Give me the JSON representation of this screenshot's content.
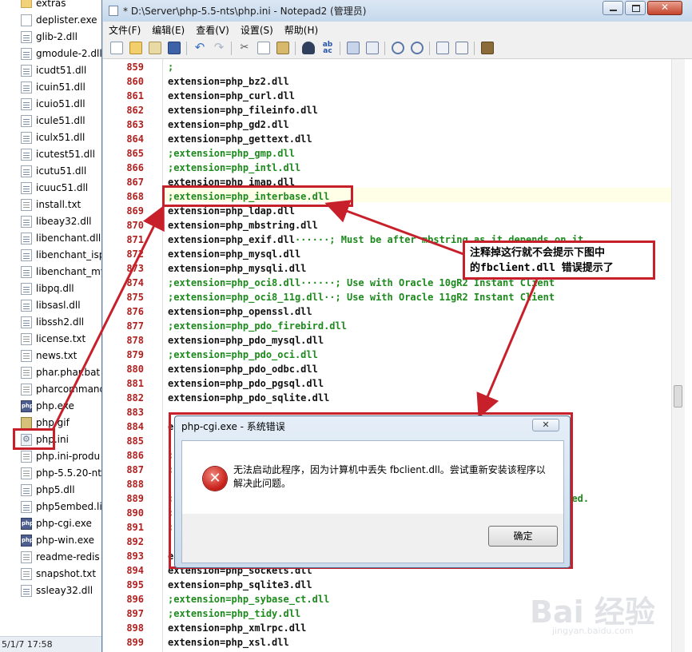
{
  "explorer": {
    "files": [
      {
        "name": "extras",
        "icon": "folder"
      },
      {
        "name": "deplister.exe",
        "icon": "exe"
      },
      {
        "name": "glib-2.dll",
        "icon": "dll"
      },
      {
        "name": "gmodule-2.dll",
        "icon": "dll"
      },
      {
        "name": "icudt51.dll",
        "icon": "dll"
      },
      {
        "name": "icuin51.dll",
        "icon": "dll"
      },
      {
        "name": "icuio51.dll",
        "icon": "dll"
      },
      {
        "name": "icule51.dll",
        "icon": "dll"
      },
      {
        "name": "iculx51.dll",
        "icon": "dll"
      },
      {
        "name": "icutest51.dll",
        "icon": "dll"
      },
      {
        "name": "icutu51.dll",
        "icon": "dll"
      },
      {
        "name": "icuuc51.dll",
        "icon": "dll"
      },
      {
        "name": "install.txt",
        "icon": "txt"
      },
      {
        "name": "libeay32.dll",
        "icon": "dll"
      },
      {
        "name": "libenchant.dll",
        "icon": "dll"
      },
      {
        "name": "libenchant_isp",
        "icon": "dll"
      },
      {
        "name": "libenchant_my",
        "icon": "dll"
      },
      {
        "name": "libpq.dll",
        "icon": "dll"
      },
      {
        "name": "libsasl.dll",
        "icon": "dll"
      },
      {
        "name": "libssh2.dll",
        "icon": "dll"
      },
      {
        "name": "license.txt",
        "icon": "txt"
      },
      {
        "name": "news.txt",
        "icon": "txt"
      },
      {
        "name": "phar.phar.bat",
        "icon": "txt"
      },
      {
        "name": "pharcommand",
        "icon": "txt"
      },
      {
        "name": "php.exe",
        "icon": "php"
      },
      {
        "name": "php.gif",
        "icon": "gif"
      },
      {
        "name": "php.ini",
        "icon": "ini"
      },
      {
        "name": "php.ini-produ",
        "icon": "txt"
      },
      {
        "name": "php-5.5.20-nt",
        "icon": "txt"
      },
      {
        "name": "php5.dll",
        "icon": "dll"
      },
      {
        "name": "php5embed.li",
        "icon": "dll"
      },
      {
        "name": "php-cgi.exe",
        "icon": "php"
      },
      {
        "name": "php-win.exe",
        "icon": "php"
      },
      {
        "name": "readme-redis",
        "icon": "txt"
      },
      {
        "name": "snapshot.txt",
        "icon": "txt"
      },
      {
        "name": "ssleay32.dll",
        "icon": "dll"
      }
    ],
    "status": "5/1/7 17:58"
  },
  "notepad": {
    "title": "* D:\\Server\\php-5.5-nts\\php.ini - Notepad2 (管理员)",
    "menu": [
      "文件(F)",
      "编辑(E)",
      "查看(V)",
      "设置(S)",
      "帮助(H)"
    ],
    "lines": [
      {
        "n": "859",
        "t": ";",
        "c": true
      },
      {
        "n": "860",
        "t": "extension=php_bz2.dll",
        "c": false
      },
      {
        "n": "861",
        "t": "extension=php_curl.dll",
        "c": false
      },
      {
        "n": "862",
        "t": "extension=php_fileinfo.dll",
        "c": false
      },
      {
        "n": "863",
        "t": "extension=php_gd2.dll",
        "c": false
      },
      {
        "n": "864",
        "t": "extension=php_gettext.dll",
        "c": false
      },
      {
        "n": "865",
        "t": ";extension=php_gmp.dll",
        "c": true
      },
      {
        "n": "866",
        "t": ";extension=php_intl.dll",
        "c": true
      },
      {
        "n": "867",
        "t": "extension=php_imap.dll",
        "c": false
      },
      {
        "n": "868",
        "t": ";extension=php_interbase.dll",
        "c": true
      },
      {
        "n": "869",
        "t": "extension=php_ldap.dll",
        "c": false
      },
      {
        "n": "870",
        "t": "extension=php_mbstring.dll",
        "c": false
      },
      {
        "n": "871",
        "t": "extension=php_exif.dll",
        "c": false,
        "tail": "······; Must be after mbstring as it depends on it"
      },
      {
        "n": "872",
        "t": "extension=php_mysql.dll",
        "c": false
      },
      {
        "n": "873",
        "t": "extension=php_mysqli.dll",
        "c": false
      },
      {
        "n": "874",
        "t": ";extension=php_oci8.dll······; Use with Oracle 10gR2 Instant Client",
        "c": true
      },
      {
        "n": "875",
        "t": ";extension=php_oci8_11g.dll··; Use with Oracle 11gR2 Instant Client",
        "c": true
      },
      {
        "n": "876",
        "t": "extension=php_openssl.dll",
        "c": false
      },
      {
        "n": "877",
        "t": ";extension=php_pdo_firebird.dll",
        "c": true
      },
      {
        "n": "878",
        "t": "extension=php_pdo_mysql.dll",
        "c": false
      },
      {
        "n": "879",
        "t": ";extension=php_pdo_oci.dll",
        "c": true
      },
      {
        "n": "880",
        "t": "extension=php_pdo_odbc.dll",
        "c": false
      },
      {
        "n": "881",
        "t": "extension=php_pdo_pgsql.dll",
        "c": false
      },
      {
        "n": "882",
        "t": "extension=php_pdo_sqlite.dll",
        "c": false
      },
      {
        "n": "883",
        "t": "",
        "c": false
      },
      {
        "n": "884",
        "t": "e",
        "c": false
      },
      {
        "n": "885",
        "t": "",
        "c": false
      },
      {
        "n": "886",
        "t": ";",
        "c": true
      },
      {
        "n": "887",
        "t": ";",
        "c": true
      },
      {
        "n": "888",
        "t": "",
        "c": false
      },
      {
        "n": "889",
        "t": ";",
        "c": true,
        "tail": "lled.",
        "tailx": 700
      },
      {
        "n": "890",
        "t": ";",
        "c": true
      },
      {
        "n": "891",
        "t": ";",
        "c": true
      },
      {
        "n": "892",
        "t": "",
        "c": false
      },
      {
        "n": "893",
        "t": "e",
        "c": false
      },
      {
        "n": "894",
        "t": "extension=php_sockets.dll",
        "c": false
      },
      {
        "n": "895",
        "t": "extension=php_sqlite3.dll",
        "c": false
      },
      {
        "n": "896",
        "t": ";extension=php_sybase_ct.dll",
        "c": true
      },
      {
        "n": "897",
        "t": ";extension=php_tidy.dll",
        "c": true
      },
      {
        "n": "898",
        "t": "extension=php_xmlrpc.dll",
        "c": false
      },
      {
        "n": "899",
        "t": "extension=php_xsl.dll",
        "c": false
      }
    ]
  },
  "annotation": {
    "callout_line1": "注释掉这行就不会提示下图中",
    "callout_line2": "的fbclient.dll 错误提示了"
  },
  "dialog": {
    "title": "php-cgi.exe - 系统错误",
    "close_label": "✕",
    "message": "无法启动此程序，因为计算机中丢失 fbclient.dll。尝试重新安装该程序以解决此问题。",
    "ok_label": "确定"
  },
  "watermark": {
    "text": "Bai 经验",
    "sub": "jingyan.baidu.com"
  },
  "colors": {
    "highlight_red": "#c8202a",
    "line_number": "#b11f1f",
    "comment_green": "#1d8a1d"
  }
}
